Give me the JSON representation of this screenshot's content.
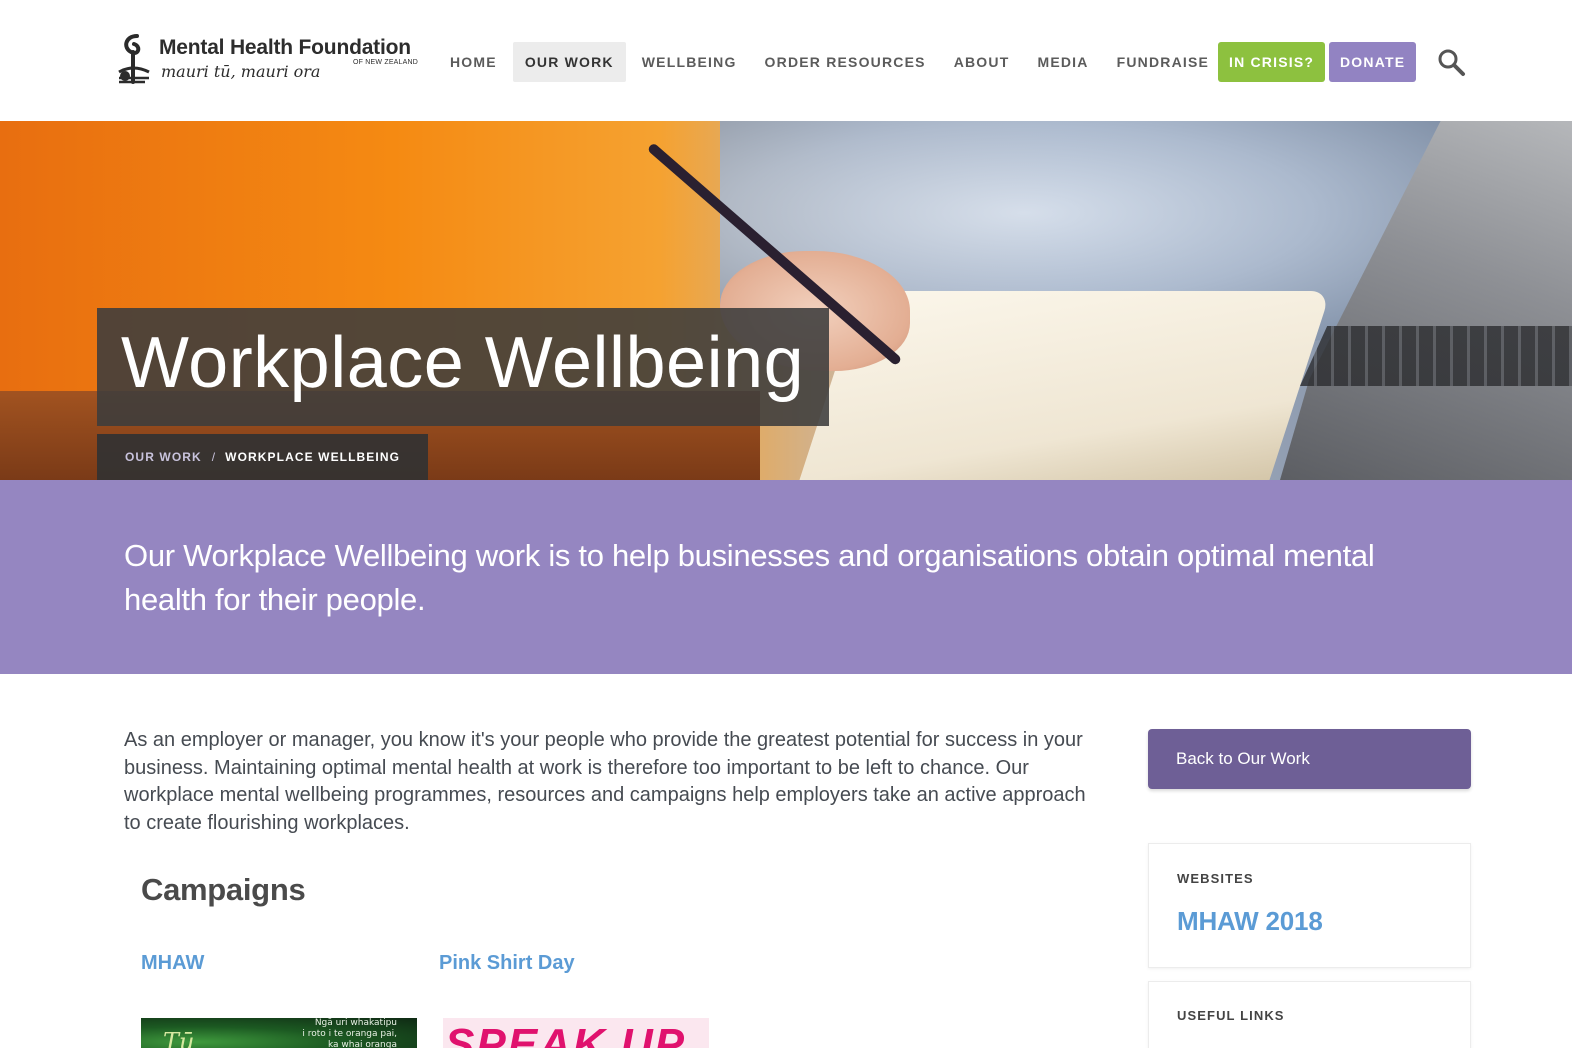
{
  "header": {
    "logo": {
      "title": "Mental Health Foundation",
      "tagline": "mauri tū, mauri ora",
      "country": "OF NEW ZEALAND"
    },
    "nav": [
      {
        "label": "HOME",
        "active": false
      },
      {
        "label": "OUR WORK",
        "active": true
      },
      {
        "label": "WELLBEING",
        "active": false
      },
      {
        "label": "ORDER RESOURCES",
        "active": false
      },
      {
        "label": "ABOUT",
        "active": false
      },
      {
        "label": "MEDIA",
        "active": false
      },
      {
        "label": "FUNDRAISE",
        "active": false
      }
    ],
    "crisis_button": "IN CRISIS?",
    "donate_button": "DONATE",
    "search_icon": "search-icon"
  },
  "hero": {
    "title": "Workplace Wellbeing",
    "breadcrumb": {
      "parent": "OUR WORK",
      "separator": "/",
      "current": "WORKPLACE WELLBEING"
    }
  },
  "intro": {
    "text": "Our Workplace Wellbeing work is to help businesses and organisations obtain optimal mental health for their people."
  },
  "main": {
    "paragraph": "As an employer or manager, you know it's your people who provide the greatest potential for success in your business. Maintaining optimal mental health at work is therefore too important to be left to chance. Our workplace mental wellbeing programmes, resources and campaigns help employers take an active approach to create flourishing workplaces.",
    "campaigns_title": "Campaigns",
    "campaigns": [
      {
        "title": "MHAW",
        "thumb_text": "Ngā uri whakatipu\ni roto i te oranga pai,\nka whai oranga"
      },
      {
        "title": "Pink Shirt Day",
        "thumb_text": "SPEAK UP"
      }
    ]
  },
  "sidebar": {
    "back_button": "Back to Our Work",
    "websites": {
      "label": "WEBSITES",
      "link": "MHAW 2018"
    },
    "useful_links": {
      "label": "USEFUL LINKS"
    }
  },
  "colors": {
    "purple_band": "#9586c1",
    "dark_purple": "#6e5f96",
    "green": "#8dc13f",
    "link_blue": "#5b9bd5"
  }
}
